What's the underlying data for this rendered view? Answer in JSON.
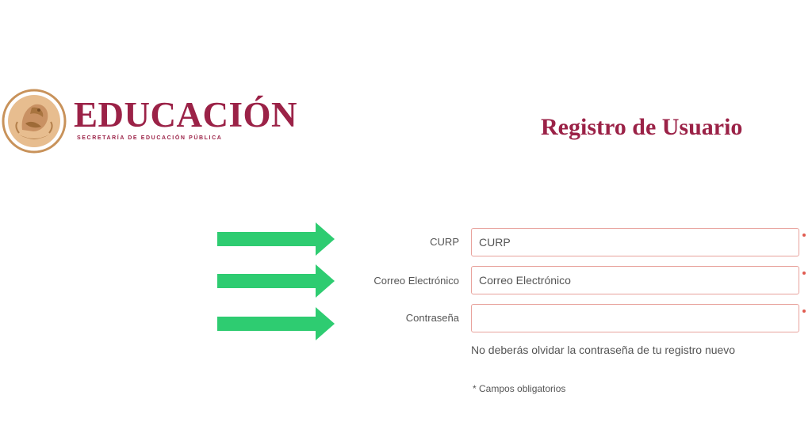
{
  "header": {
    "brand_name": "EDUCACIÓN",
    "brand_subtitle": "SECRETARÍA DE EDUCACIÓN PÚBLICA",
    "page_title": "Registro de Usuario"
  },
  "form": {
    "fields": [
      {
        "label": "CURP",
        "value": "CURP"
      },
      {
        "label": "Correo Electrónico",
        "value": "Correo Electrónico"
      },
      {
        "label": "Contraseña",
        "value": ""
      }
    ],
    "help_text": "No deberás olvidar la contraseña de tu registro nuevo",
    "required_note": "* Campos obligatorios"
  },
  "colors": {
    "brand": "#9b2247",
    "emblem_gold": "#c8925a",
    "field_border": "#e8a29c",
    "arrow_green": "#2ecc71"
  },
  "icons": {
    "emblem": "national-emblem-icon",
    "arrow": "arrow-right-icon"
  }
}
